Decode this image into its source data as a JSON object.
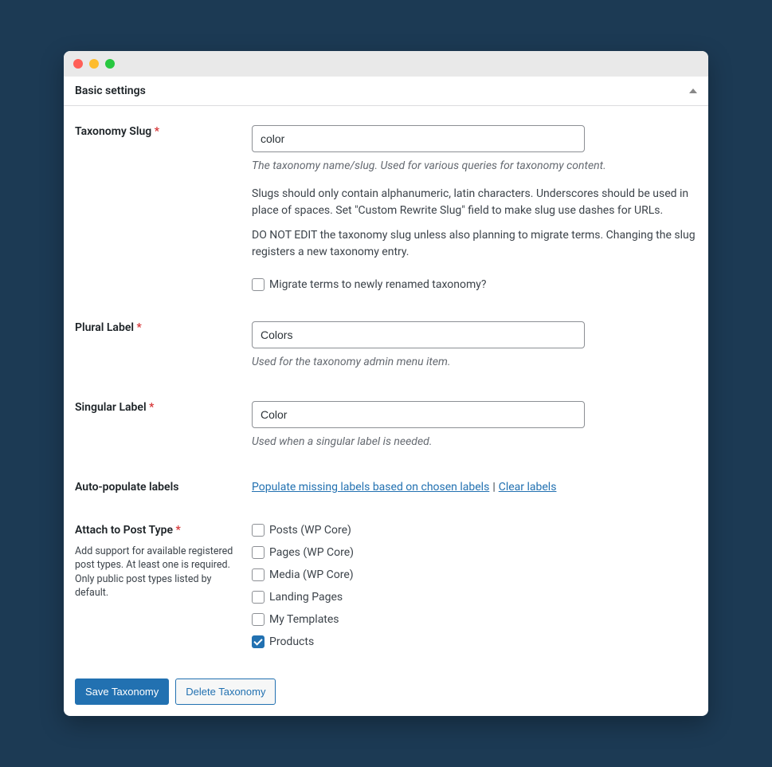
{
  "section_title": "Basic settings",
  "fields": {
    "slug": {
      "label": "Taxonomy Slug",
      "value": "color",
      "desc": "The taxonomy name/slug. Used for various queries for taxonomy content.",
      "note1": "Slugs should only contain alphanumeric, latin characters. Underscores should be used in place of spaces. Set \"Custom Rewrite Slug\" field to make slug use dashes for URLs.",
      "note2": "DO NOT EDIT the taxonomy slug unless also planning to migrate terms. Changing the slug registers a new taxonomy entry.",
      "migrate_label": "Migrate terms to newly renamed taxonomy?"
    },
    "plural": {
      "label": "Plural Label",
      "value": "Colors",
      "desc": "Used for the taxonomy admin menu item."
    },
    "singular": {
      "label": "Singular Label",
      "value": "Color",
      "desc": "Used when a singular label is needed."
    },
    "autopop": {
      "label": "Auto-populate labels",
      "link1": "Populate missing labels based on chosen labels",
      "link2": "Clear labels"
    },
    "attach": {
      "label": "Attach to Post Type",
      "help": "Add support for available registered post types. At least one is required. Only public post types listed by default.",
      "options": [
        {
          "label": "Posts (WP Core)",
          "checked": false
        },
        {
          "label": "Pages (WP Core)",
          "checked": false
        },
        {
          "label": "Media (WP Core)",
          "checked": false
        },
        {
          "label": "Landing Pages",
          "checked": false
        },
        {
          "label": "My Templates",
          "checked": false
        },
        {
          "label": "Products",
          "checked": true
        }
      ]
    }
  },
  "actions": {
    "save": "Save Taxonomy",
    "delete": "Delete Taxonomy"
  }
}
